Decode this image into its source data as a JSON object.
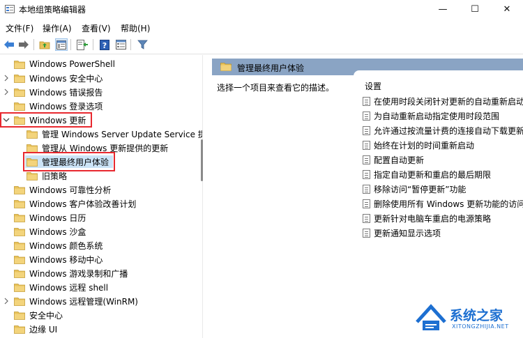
{
  "window": {
    "title": "本地组策略编辑器",
    "minimize": "—",
    "maximize": "☐",
    "close": "✕"
  },
  "menu": {
    "items": [
      {
        "label": "文件(F)"
      },
      {
        "label": "操作(A)"
      },
      {
        "label": "查看(V)"
      },
      {
        "label": "帮助(H)"
      }
    ]
  },
  "toolbar": {
    "icons": [
      "back-arrow-icon",
      "forward-arrow-icon",
      "up-folder-icon",
      "show-hide-tree-icon",
      "export-list-icon",
      "help-icon",
      "properties-view-icon",
      "filter-icon"
    ]
  },
  "tree": {
    "items": [
      {
        "label": "Windows PowerShell",
        "level": 0,
        "arrow": false
      },
      {
        "label": "Windows 安全中心",
        "level": 0,
        "arrow": true
      },
      {
        "label": "Windows 错误报告",
        "level": 0,
        "arrow": true
      },
      {
        "label": "Windows 登录选项",
        "level": 0,
        "arrow": false
      },
      {
        "label": "Windows 更新",
        "level": 0,
        "arrow": true,
        "expanded": true
      },
      {
        "label": "管理 Windows Server Update Service 提",
        "level": 1,
        "arrow": false
      },
      {
        "label": "管理从 Windows 更新提供的更新",
        "level": 1,
        "arrow": false
      },
      {
        "label": "管理最终用户体验",
        "level": 1,
        "arrow": false,
        "selected": true
      },
      {
        "label": "旧策略",
        "level": 1,
        "arrow": false
      },
      {
        "label": "Windows 可靠性分析",
        "level": 0,
        "arrow": false
      },
      {
        "label": "Windows 客户体验改善计划",
        "level": 0,
        "arrow": false
      },
      {
        "label": "Windows 日历",
        "level": 0,
        "arrow": false
      },
      {
        "label": "Windows 沙盒",
        "level": 0,
        "arrow": false
      },
      {
        "label": "Windows 颜色系统",
        "level": 0,
        "arrow": false
      },
      {
        "label": "Windows 移动中心",
        "level": 0,
        "arrow": false
      },
      {
        "label": "Windows 游戏录制和广播",
        "level": 0,
        "arrow": false
      },
      {
        "label": "Windows 远程 shell",
        "level": 0,
        "arrow": false
      },
      {
        "label": "Windows 远程管理(WinRM)",
        "level": 0,
        "arrow": true
      },
      {
        "label": "安全中心",
        "level": 0,
        "arrow": false
      },
      {
        "label": "边缘 UI",
        "level": 0,
        "arrow": false
      }
    ]
  },
  "details": {
    "header": "管理最终用户体验",
    "description": "选择一个项目来查看它的描述。",
    "column_header": "设置",
    "policies": [
      {
        "label": "在使用时段关闭针对更新的自动重新启动"
      },
      {
        "label": "为自动重新启动指定使用时段范围"
      },
      {
        "label": "允许通过按流量计费的连接自动下载更新"
      },
      {
        "label": "始终在计划的时间重新启动"
      },
      {
        "label": "配置自动更新"
      },
      {
        "label": "指定自动更新和重启的最后期限"
      },
      {
        "label": "移除访问“暂停更新”功能"
      },
      {
        "label": "删除使用所有 Windows 更新功能的访问"
      },
      {
        "label": "更新针对电脑车重启的电源策略"
      },
      {
        "label": "更新通知显示选项"
      }
    ]
  },
  "watermark": {
    "text": "系统之家",
    "sub": "XITONGZHIJIA.NET"
  },
  "colors": {
    "highlight_border": "#e8282f",
    "selected_bg": "#cce4f7",
    "header_bg": "#8aa4c4",
    "folder": "#e8c25a"
  }
}
